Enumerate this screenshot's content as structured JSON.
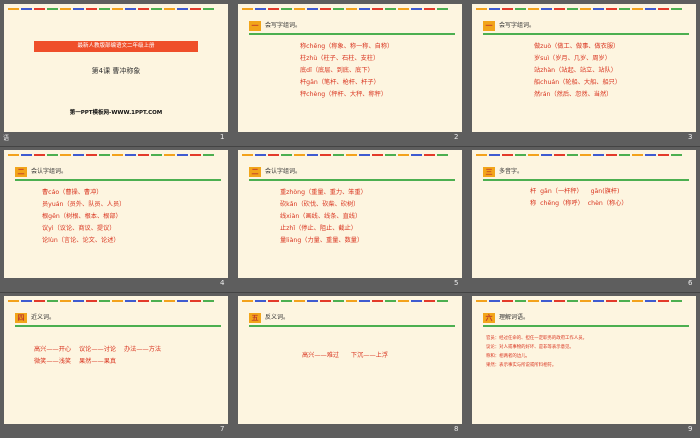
{
  "colors": {
    "stripe1": "#f3a21c",
    "stripe2": "#3f5bd0",
    "stripe3": "#e33a2a",
    "stripe4": "#4caf50",
    "badge": "#f2a51a",
    "text_red": "#d9341f"
  },
  "slide1": {
    "banner": "最新人教版部编语文二年级上册",
    "title": "第4课  曹冲称象",
    "footer": "第一PPT模板网-WWW.1PPT.COM",
    "label_left": "语",
    "num": "1"
  },
  "slide2": {
    "badge": "一",
    "heading": "会写字组词。",
    "lines": "称chēng（称象、称一称、自称）\n柱zhù（柱子、石柱、支柱）\n底dǐ（底层、到底、底下）\n杆gān（笔杆、枪杆、杆子）\n秤chèng（秤杆、大秤、称秤）",
    "num": "2"
  },
  "slide3": {
    "badge": "一",
    "heading": "会写字组词。",
    "lines": "做zuò（做工、做事、做衣服）\n岁suì（岁月、几岁、周岁）\n站zhàn（站起、站立、站队）\n船chuán（轮船、大船、船只）\n然rán（然后、忽然、当然）",
    "num": "3"
  },
  "slide4": {
    "badge": "二",
    "heading": "会认字组词。",
    "lines": "曹cáo（曹操、曹冲）\n员yuán（员外、队员、人员）\n根gēn（树根、根本、根部）\n议yì（议论、商议、提议）\n论lùn（言论、论文、论述）",
    "num": "4"
  },
  "slide5": {
    "badge": "二",
    "heading": "会认字组词。",
    "lines": "重zhòng（重量、重力、笨重）\n砍kǎn（砍伐、砍柴、砍树）\n线xiàn（画线、线条、直线）\n止zhǐ（停止、阻止、截止）\n量liàng（力量、重量、数量）",
    "num": "5"
  },
  "slide6": {
    "badge": "三",
    "heading": "多音字。",
    "lines": "杆  gān（一杆秤）    gān(旗杆)\n称  chēng（称呼）  chèn（称心）",
    "num": "6"
  },
  "slide7": {
    "badge": "四",
    "heading": "近义词。",
    "lines": "高兴——开心    议论——讨论    办法——方法\n微笑——浅笑    果然——果真",
    "num": "7"
  },
  "slide8": {
    "badge": "五",
    "heading": "反义词。",
    "lines": "高兴——难过      下沉——上浮",
    "num": "8"
  },
  "slide9": {
    "badge": "六",
    "heading": "理解词语。",
    "lines": "官员：经过任命的、担任一定职务的政府工作人员。\n议论：对人或事物的好坏、是非等表示意见。\n称和：相两者的边儿。\n果然：表示事实与所说或所料相符。",
    "num": "9"
  }
}
